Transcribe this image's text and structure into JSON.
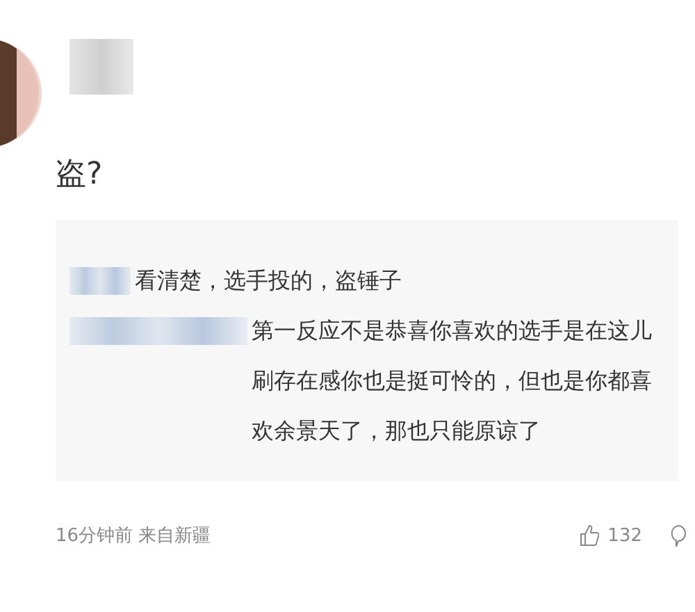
{
  "comment": {
    "text": "盗?",
    "replies": [
      {
        "text": "看清楚，选手投的，盗锤子"
      },
      {
        "text": "第一反应不是恭喜你喜欢的选手是在这儿刷存在感你也是挺可怜的，但也是你都喜欢余景天了，那也只能原谅了"
      }
    ],
    "time": "16分钟前",
    "location": "来自新疆",
    "likes": "132"
  }
}
